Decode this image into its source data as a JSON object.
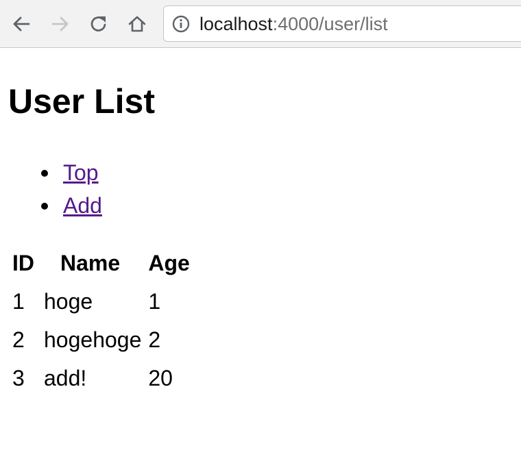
{
  "browser": {
    "url_host": "localhost",
    "url_rest": ":4000/user/list"
  },
  "page": {
    "title": "User List",
    "links": [
      {
        "label": "Top"
      },
      {
        "label": "Add"
      }
    ],
    "table": {
      "headers": [
        "ID",
        "Name",
        "Age"
      ],
      "rows": [
        [
          "1",
          "hoge",
          "1"
        ],
        [
          "2",
          "hogehoge",
          "2"
        ],
        [
          "3",
          "add!",
          "20"
        ]
      ]
    }
  },
  "colors": {
    "link": "#551a8b",
    "toolbar": "#f2f2f2"
  }
}
